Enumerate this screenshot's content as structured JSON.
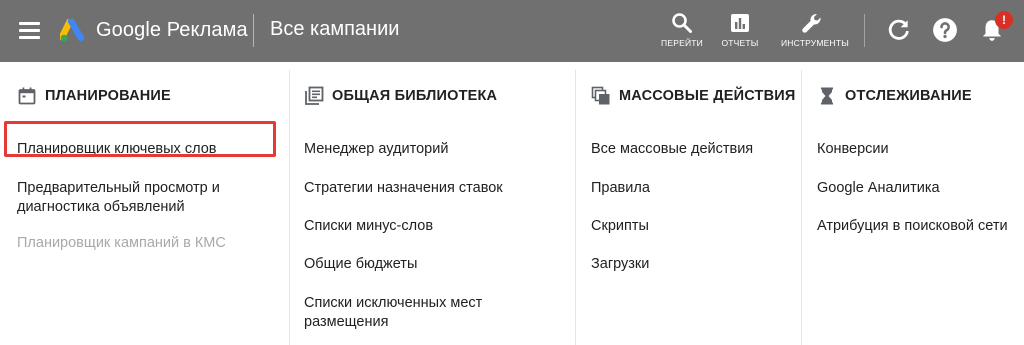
{
  "topbar": {
    "brand": "Google Реклама",
    "page_title": "Все кампании",
    "tools": [
      {
        "label": "ПЕРЕЙТИ",
        "icon": "search-icon"
      },
      {
        "label": "ОТЧЕТЫ",
        "icon": "reports-icon"
      },
      {
        "label": "ИНСТРУМЕНТЫ",
        "icon": "wrench-icon"
      }
    ],
    "notification_badge": "!",
    "colors": {
      "bar": "#707070",
      "badge": "#d93025",
      "highlight": "#e53935"
    }
  },
  "menu": {
    "columns": [
      {
        "heading": "ПЛАНИРОВАНИЕ",
        "icon": "calendar-icon",
        "items": [
          {
            "label": "Планировщик ключевых слов",
            "highlighted": true
          },
          {
            "label_line1": "Предварительный просмотр и",
            "label_line2": "диагностика объявлений"
          },
          {
            "label": "Планировщик кампаний в КМС",
            "disabled": true
          }
        ]
      },
      {
        "heading": "ОБЩАЯ БИБЛИОТЕКА",
        "icon": "library-icon",
        "items": [
          {
            "label": "Менеджер аудиторий"
          },
          {
            "label": "Стратегии назначения ставок"
          },
          {
            "label": "Списки минус-слов"
          },
          {
            "label": "Общие бюджеты"
          },
          {
            "label_line1": "Списки исключенных мест",
            "label_line2": "размещения"
          }
        ]
      },
      {
        "heading": "МАССОВЫЕ ДЕЙСТВИЯ",
        "icon": "bulk-actions-icon",
        "items": [
          {
            "label": "Все массовые действия"
          },
          {
            "label": "Правила"
          },
          {
            "label": "Скрипты"
          },
          {
            "label": "Загрузки"
          }
        ]
      },
      {
        "heading": "ОТСЛЕЖИВАНИЕ",
        "icon": "hourglass-icon",
        "items": [
          {
            "label": "Конверсии"
          },
          {
            "label": "Google Аналитика"
          },
          {
            "label": "Атрибуция в поисковой сети"
          }
        ]
      }
    ]
  }
}
